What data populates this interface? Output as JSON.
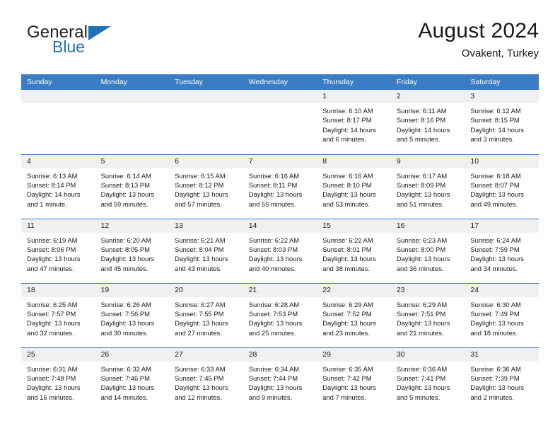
{
  "brand": {
    "name_part1": "General",
    "name_part2": "Blue",
    "logo_icon": "blue-triangle-icon"
  },
  "header": {
    "title": "August 2024",
    "subtitle": "Ovakent, Turkey"
  },
  "colors": {
    "header_blue": "#3b7dc4",
    "brand_blue": "#1d72b8",
    "daynum_bg": "#f0f0f0",
    "text": "#1a1a1a"
  },
  "weekdays": [
    "Sunday",
    "Monday",
    "Tuesday",
    "Wednesday",
    "Thursday",
    "Friday",
    "Saturday"
  ],
  "weeks": [
    [
      {
        "day": "",
        "empty": true
      },
      {
        "day": "",
        "empty": true
      },
      {
        "day": "",
        "empty": true
      },
      {
        "day": "",
        "empty": true
      },
      {
        "day": "1",
        "sunrise": "Sunrise: 6:10 AM",
        "sunset": "Sunset: 8:17 PM",
        "daylight1": "Daylight: 14 hours",
        "daylight2": "and 6 minutes."
      },
      {
        "day": "2",
        "sunrise": "Sunrise: 6:11 AM",
        "sunset": "Sunset: 8:16 PM",
        "daylight1": "Daylight: 14 hours",
        "daylight2": "and 5 minutes."
      },
      {
        "day": "3",
        "sunrise": "Sunrise: 6:12 AM",
        "sunset": "Sunset: 8:15 PM",
        "daylight1": "Daylight: 14 hours",
        "daylight2": "and 3 minutes."
      }
    ],
    [
      {
        "day": "4",
        "sunrise": "Sunrise: 6:13 AM",
        "sunset": "Sunset: 8:14 PM",
        "daylight1": "Daylight: 14 hours",
        "daylight2": "and 1 minute."
      },
      {
        "day": "5",
        "sunrise": "Sunrise: 6:14 AM",
        "sunset": "Sunset: 8:13 PM",
        "daylight1": "Daylight: 13 hours",
        "daylight2": "and 59 minutes."
      },
      {
        "day": "6",
        "sunrise": "Sunrise: 6:15 AM",
        "sunset": "Sunset: 8:12 PM",
        "daylight1": "Daylight: 13 hours",
        "daylight2": "and 57 minutes."
      },
      {
        "day": "7",
        "sunrise": "Sunrise: 6:16 AM",
        "sunset": "Sunset: 8:11 PM",
        "daylight1": "Daylight: 13 hours",
        "daylight2": "and 55 minutes."
      },
      {
        "day": "8",
        "sunrise": "Sunrise: 6:16 AM",
        "sunset": "Sunset: 8:10 PM",
        "daylight1": "Daylight: 13 hours",
        "daylight2": "and 53 minutes."
      },
      {
        "day": "9",
        "sunrise": "Sunrise: 6:17 AM",
        "sunset": "Sunset: 8:09 PM",
        "daylight1": "Daylight: 13 hours",
        "daylight2": "and 51 minutes."
      },
      {
        "day": "10",
        "sunrise": "Sunrise: 6:18 AM",
        "sunset": "Sunset: 8:07 PM",
        "daylight1": "Daylight: 13 hours",
        "daylight2": "and 49 minutes."
      }
    ],
    [
      {
        "day": "11",
        "sunrise": "Sunrise: 6:19 AM",
        "sunset": "Sunset: 8:06 PM",
        "daylight1": "Daylight: 13 hours",
        "daylight2": "and 47 minutes."
      },
      {
        "day": "12",
        "sunrise": "Sunrise: 6:20 AM",
        "sunset": "Sunset: 8:05 PM",
        "daylight1": "Daylight: 13 hours",
        "daylight2": "and 45 minutes."
      },
      {
        "day": "13",
        "sunrise": "Sunrise: 6:21 AM",
        "sunset": "Sunset: 8:04 PM",
        "daylight1": "Daylight: 13 hours",
        "daylight2": "and 43 minutes."
      },
      {
        "day": "14",
        "sunrise": "Sunrise: 6:22 AM",
        "sunset": "Sunset: 8:03 PM",
        "daylight1": "Daylight: 13 hours",
        "daylight2": "and 40 minutes."
      },
      {
        "day": "15",
        "sunrise": "Sunrise: 6:22 AM",
        "sunset": "Sunset: 8:01 PM",
        "daylight1": "Daylight: 13 hours",
        "daylight2": "and 38 minutes."
      },
      {
        "day": "16",
        "sunrise": "Sunrise: 6:23 AM",
        "sunset": "Sunset: 8:00 PM",
        "daylight1": "Daylight: 13 hours",
        "daylight2": "and 36 minutes."
      },
      {
        "day": "17",
        "sunrise": "Sunrise: 6:24 AM",
        "sunset": "Sunset: 7:59 PM",
        "daylight1": "Daylight: 13 hours",
        "daylight2": "and 34 minutes."
      }
    ],
    [
      {
        "day": "18",
        "sunrise": "Sunrise: 6:25 AM",
        "sunset": "Sunset: 7:57 PM",
        "daylight1": "Daylight: 13 hours",
        "daylight2": "and 32 minutes."
      },
      {
        "day": "19",
        "sunrise": "Sunrise: 6:26 AM",
        "sunset": "Sunset: 7:56 PM",
        "daylight1": "Daylight: 13 hours",
        "daylight2": "and 30 minutes."
      },
      {
        "day": "20",
        "sunrise": "Sunrise: 6:27 AM",
        "sunset": "Sunset: 7:55 PM",
        "daylight1": "Daylight: 13 hours",
        "daylight2": "and 27 minutes."
      },
      {
        "day": "21",
        "sunrise": "Sunrise: 6:28 AM",
        "sunset": "Sunset: 7:53 PM",
        "daylight1": "Daylight: 13 hours",
        "daylight2": "and 25 minutes."
      },
      {
        "day": "22",
        "sunrise": "Sunrise: 6:29 AM",
        "sunset": "Sunset: 7:52 PM",
        "daylight1": "Daylight: 13 hours",
        "daylight2": "and 23 minutes."
      },
      {
        "day": "23",
        "sunrise": "Sunrise: 6:29 AM",
        "sunset": "Sunset: 7:51 PM",
        "daylight1": "Daylight: 13 hours",
        "daylight2": "and 21 minutes."
      },
      {
        "day": "24",
        "sunrise": "Sunrise: 6:30 AM",
        "sunset": "Sunset: 7:49 PM",
        "daylight1": "Daylight: 13 hours",
        "daylight2": "and 18 minutes."
      }
    ],
    [
      {
        "day": "25",
        "sunrise": "Sunrise: 6:31 AM",
        "sunset": "Sunset: 7:48 PM",
        "daylight1": "Daylight: 13 hours",
        "daylight2": "and 16 minutes."
      },
      {
        "day": "26",
        "sunrise": "Sunrise: 6:32 AM",
        "sunset": "Sunset: 7:46 PM",
        "daylight1": "Daylight: 13 hours",
        "daylight2": "and 14 minutes."
      },
      {
        "day": "27",
        "sunrise": "Sunrise: 6:33 AM",
        "sunset": "Sunset: 7:45 PM",
        "daylight1": "Daylight: 13 hours",
        "daylight2": "and 12 minutes."
      },
      {
        "day": "28",
        "sunrise": "Sunrise: 6:34 AM",
        "sunset": "Sunset: 7:44 PM",
        "daylight1": "Daylight: 13 hours",
        "daylight2": "and 9 minutes."
      },
      {
        "day": "29",
        "sunrise": "Sunrise: 6:35 AM",
        "sunset": "Sunset: 7:42 PM",
        "daylight1": "Daylight: 13 hours",
        "daylight2": "and 7 minutes."
      },
      {
        "day": "30",
        "sunrise": "Sunrise: 6:36 AM",
        "sunset": "Sunset: 7:41 PM",
        "daylight1": "Daylight: 13 hours",
        "daylight2": "and 5 minutes."
      },
      {
        "day": "31",
        "sunrise": "Sunrise: 6:36 AM",
        "sunset": "Sunset: 7:39 PM",
        "daylight1": "Daylight: 13 hours",
        "daylight2": "and 2 minutes."
      }
    ]
  ]
}
